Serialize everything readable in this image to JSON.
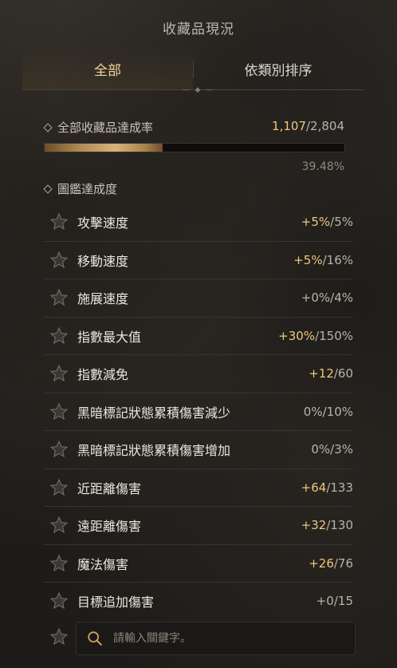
{
  "header": {
    "title": "收藏品現況"
  },
  "tabs": [
    {
      "label": "全部",
      "active": true
    },
    {
      "label": "依類別排序",
      "active": false
    }
  ],
  "collection": {
    "label": "全部收藏品達成率",
    "current": "1,107",
    "total": "/2,804",
    "percent_text": "39.48%",
    "progress_fraction": 0.3948
  },
  "codex": {
    "label": "圖鑑達成度"
  },
  "rows": [
    {
      "label": "攻擊速度",
      "value": "+5%",
      "max": "/5%",
      "highlight": true
    },
    {
      "label": "移動速度",
      "value": "+5%",
      "max": "/16%",
      "highlight": true
    },
    {
      "label": "施展速度",
      "value": "+0%",
      "max": "/4%",
      "highlight": false
    },
    {
      "label": "指數最大值",
      "value": "+30%",
      "max": "/150%",
      "highlight": true
    },
    {
      "label": "指數減免",
      "value": "+12",
      "max": "/60",
      "highlight": true
    },
    {
      "label": "黑暗標記狀態累積傷害減少",
      "value": "0%",
      "max": "/10%",
      "highlight": false
    },
    {
      "label": "黑暗標記狀態累積傷害增加",
      "value": "0%",
      "max": "/3%",
      "highlight": false
    },
    {
      "label": "近距離傷害",
      "value": "+64",
      "max": "/133",
      "highlight": true
    },
    {
      "label": "遠距離傷害",
      "value": "+32",
      "max": "/130",
      "highlight": true
    },
    {
      "label": "魔法傷害",
      "value": "+26",
      "max": "/76",
      "highlight": true
    },
    {
      "label": "目標追加傷害",
      "value": "+0",
      "max": "/15",
      "highlight": false
    }
  ],
  "search": {
    "placeholder": "請輸入關鍵字。",
    "value": ""
  },
  "colors": {
    "accent_gold": "#efc77a",
    "muted": "#b9b3a8"
  },
  "icons": {
    "row_icon": "star-icon",
    "search_icon": "magnifier-icon"
  }
}
